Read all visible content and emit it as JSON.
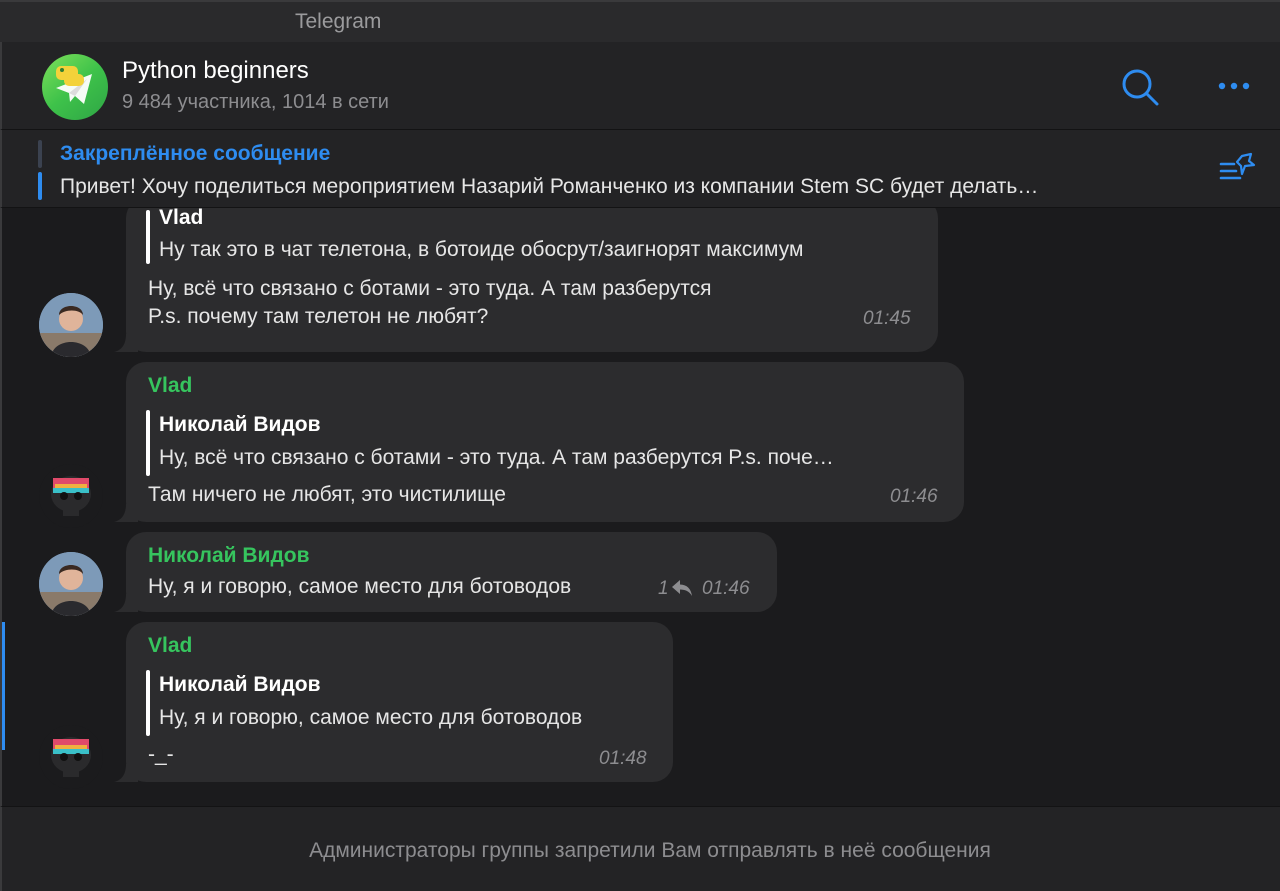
{
  "window": {
    "title": "Telegram"
  },
  "colors": {
    "accent": "#2e8cf0",
    "sender": "#36c55e",
    "bubble": "#2c2c2e",
    "background": "#1b1b1d"
  },
  "header": {
    "name": "Python beginners",
    "subtitle": "9 484 участника, 1014 в сети",
    "search_icon": "search-icon",
    "more_icon": "more-dots-icon"
  },
  "pinned": {
    "title": "Закреплённое сообщение",
    "text": "Привет! Хочу поделиться мероприятием  Назарий Романченко из компании Stem SC будет делать…",
    "icon": "pinned-list-icon"
  },
  "messages": [
    {
      "sender": "",
      "reply_name": "Vlad",
      "reply_text": "Ну так это в чат телетона, в ботоиде обосрут/заигнорят максимум",
      "lines": [
        "Ну, всё что связано с ботами - это туда. А там разберутся",
        "P.s. почему там телетон не любят?"
      ],
      "time": "01:45"
    },
    {
      "sender": "Vlad",
      "reply_name": "Николай Видов",
      "reply_text": "Ну, всё что связано с ботами - это туда. А там разберутся P.s. поче…",
      "lines": [
        "Там ничего не любят, это чистилище"
      ],
      "time": "01:46"
    },
    {
      "sender": "Николай Видов",
      "lines": [
        "Ну, я и говорю, самое место для ботоводов"
      ],
      "replies_count": "1",
      "time": "01:46"
    },
    {
      "sender": "Vlad",
      "reply_name": "Николай Видов",
      "reply_text": "Ну, я и говорю, самое место для ботоводов",
      "lines": [
        "-_-"
      ],
      "time": "01:48"
    }
  ],
  "footer": {
    "text": "Администраторы группы запретили Вам отправлять в неё сообщения"
  }
}
